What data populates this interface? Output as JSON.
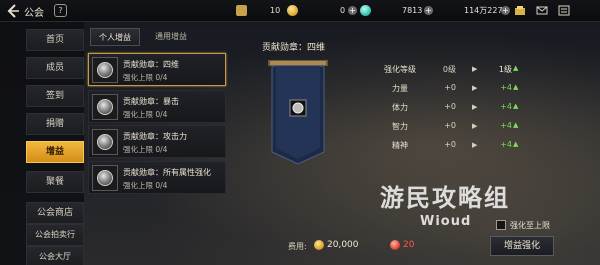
{
  "topbar": {
    "title": "公会",
    "help_label": "?",
    "resources": [
      {
        "name": "tickets",
        "value": "10",
        "icon": "ticket-icon"
      },
      {
        "name": "gold",
        "value": "0",
        "icon": "gold-coin-icon"
      },
      {
        "name": "crystal",
        "value": "7813",
        "icon": "crystal-icon"
      },
      {
        "name": "silver",
        "value": "114万2276",
        "icon": "silver-coin-icon"
      }
    ]
  },
  "sidebar": {
    "items": [
      {
        "label": "首页"
      },
      {
        "label": "成员"
      },
      {
        "label": "签到"
      },
      {
        "label": "捐赠"
      },
      {
        "label": "增益",
        "active": true
      },
      {
        "label": "聚餐"
      },
      {
        "label": "公会商店"
      },
      {
        "label": "公会拍卖行"
      },
      {
        "label": "公会大厅"
      }
    ]
  },
  "tabs": [
    {
      "label": "个人增益",
      "active": true
    },
    {
      "label": "通用增益",
      "active": false
    }
  ],
  "bonus_list": [
    {
      "name": "贡献勋章：四维",
      "sub": "强化上限 0/4",
      "selected": true
    },
    {
      "name": "贡献勋章：暴击",
      "sub": "强化上限 0/4",
      "selected": false
    },
    {
      "name": "贡献勋章：攻击力",
      "sub": "强化上限 0/4",
      "selected": false
    },
    {
      "name": "贡献勋章：所有属性强化",
      "sub": "强化上限 0/4",
      "selected": false
    }
  ],
  "detail": {
    "title": "贡献勋章：四维",
    "stats": [
      {
        "label": "强化等级",
        "current": "0级",
        "next": "1级"
      },
      {
        "label": "力量",
        "current": "+0",
        "next": "+4"
      },
      {
        "label": "体力",
        "current": "+0",
        "next": "+4"
      },
      {
        "label": "智力",
        "current": "+0",
        "next": "+4"
      },
      {
        "label": "精神",
        "current": "+0",
        "next": "+4"
      }
    ]
  },
  "footer": {
    "max_label": "强化至上限",
    "cost_label": "费用:",
    "cost_gold": "20,000",
    "cost_gem": "20",
    "enhance_label": "增益强化"
  },
  "watermark": {
    "main": "游民攻略组",
    "sub": "Wioud"
  },
  "colors": {
    "accent": "#f2b73e",
    "increase": "#7ed957",
    "gem_cost": "#ff5a4a"
  }
}
